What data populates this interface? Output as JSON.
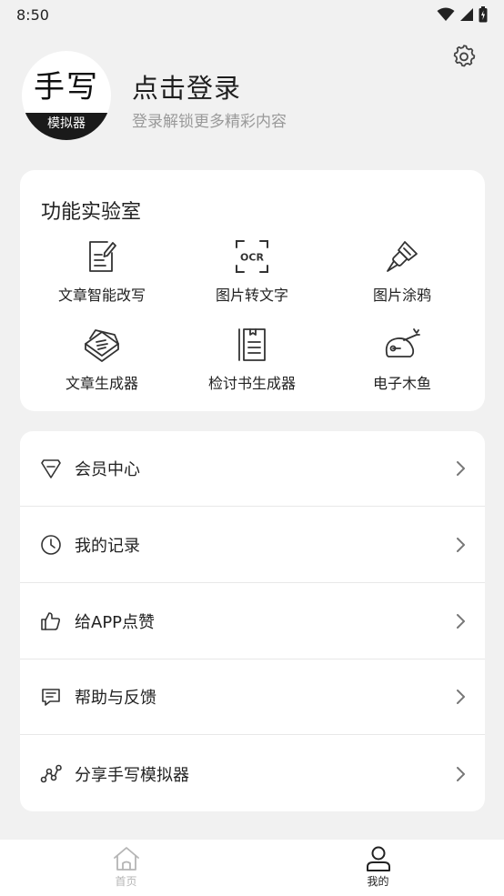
{
  "status_bar": {
    "time": "8:50"
  },
  "profile": {
    "avatar_title": "手写",
    "avatar_band": "模拟器",
    "login_title": "点击登录",
    "login_subtitle": "登录解锁更多精彩内容"
  },
  "lab": {
    "title": "功能实验室",
    "items": [
      {
        "label": "文章智能改写",
        "icon": "edit-document-icon"
      },
      {
        "label": "图片转文字",
        "icon": "ocr-icon"
      },
      {
        "label": "图片涂鸦",
        "icon": "paint-brush-icon"
      },
      {
        "label": "文章生成器",
        "icon": "stacked-papers-icon"
      },
      {
        "label": "检讨书生成器",
        "icon": "notebook-icon"
      },
      {
        "label": "电子木鱼",
        "icon": "wooden-fish-icon"
      }
    ]
  },
  "menu": {
    "items": [
      {
        "label": "会员中心",
        "icon": "diamond-icon"
      },
      {
        "label": "我的记录",
        "icon": "clock-icon"
      },
      {
        "label": "给APP点赞",
        "icon": "thumbs-up-icon"
      },
      {
        "label": "帮助与反馈",
        "icon": "feedback-icon"
      },
      {
        "label": "分享手写模拟器",
        "icon": "share-icon"
      }
    ]
  },
  "tabbar": {
    "items": [
      {
        "label": "首页",
        "icon": "home-icon",
        "active": false
      },
      {
        "label": "我的",
        "icon": "user-icon",
        "active": true
      }
    ]
  },
  "colors": {
    "background": "#f1f1f1",
    "card": "#ffffff",
    "text": "#222222",
    "muted": "#9a9a9a"
  }
}
